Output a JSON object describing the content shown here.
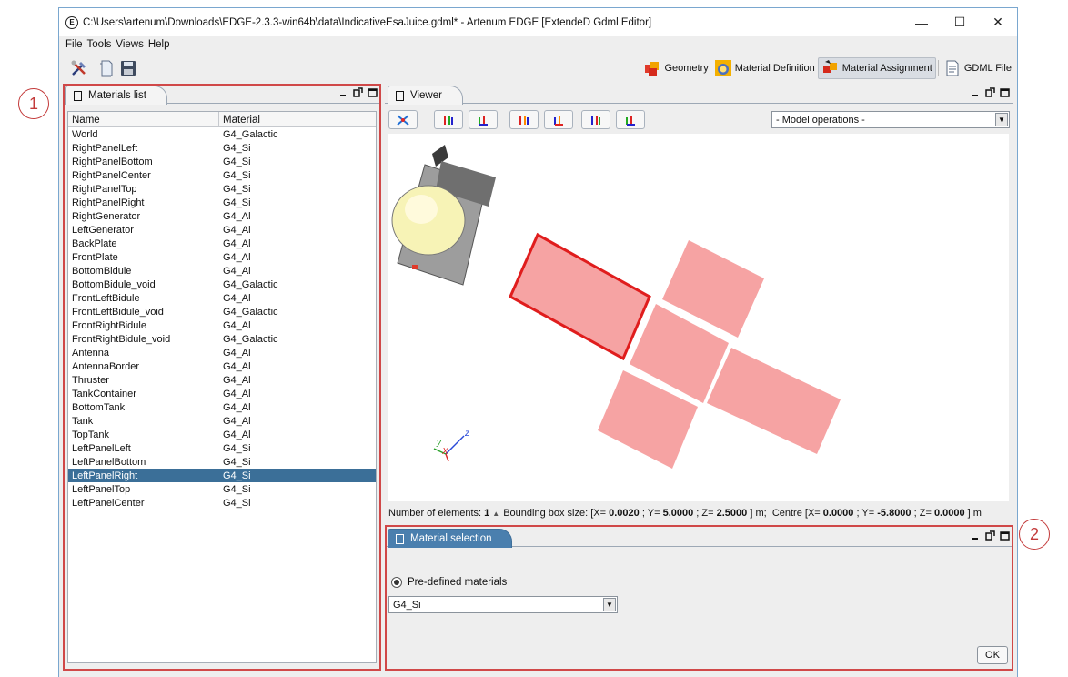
{
  "window": {
    "icon_letter": "E",
    "title": "C:\\Users\\artenum\\Downloads\\EDGE-2.3.3-win64b\\data\\IndicativeEsaJuice.gdml* - Artenum EDGE [ExtendeD Gdml Editor]",
    "controls": {
      "minimize": "—",
      "maximize": "☐",
      "close": "✕"
    }
  },
  "callouts": [
    "1",
    "2"
  ],
  "menu": [
    "File",
    "Tools",
    "Views",
    "Help"
  ],
  "toolbar": {
    "icons": [
      "tools-icon",
      "open-document-icon",
      "save-disk-icon"
    ]
  },
  "perspectives": [
    {
      "label": "Geometry",
      "icon": "geometry-cubes-icon",
      "active": false
    },
    {
      "label": "Material Definition",
      "icon": "material-definition-icon",
      "active": false
    },
    {
      "label": "Material Assignment",
      "icon": "material-assignment-icon",
      "active": true
    },
    {
      "label": "GDML File",
      "icon": "gdml-file-icon",
      "active": false
    }
  ],
  "materials_panel": {
    "tab": "Materials list",
    "columns": [
      "Name",
      "Material"
    ],
    "rows": [
      [
        "World",
        "G4_Galactic"
      ],
      [
        "RightPanelLeft",
        "G4_Si"
      ],
      [
        "RightPanelBottom",
        "G4_Si"
      ],
      [
        "RightPanelCenter",
        "G4_Si"
      ],
      [
        "RightPanelTop",
        "G4_Si"
      ],
      [
        "RightPanelRight",
        "G4_Si"
      ],
      [
        "RightGenerator",
        "G4_Al"
      ],
      [
        "LeftGenerator",
        "G4_Al"
      ],
      [
        "BackPlate",
        "G4_Al"
      ],
      [
        "FrontPlate",
        "G4_Al"
      ],
      [
        "BottomBidule",
        "G4_Al"
      ],
      [
        "BottomBidule_void",
        "G4_Galactic"
      ],
      [
        "FrontLeftBidule",
        "G4_Al"
      ],
      [
        "FrontLeftBidule_void",
        "G4_Galactic"
      ],
      [
        "FrontRightBidule",
        "G4_Al"
      ],
      [
        "FrontRightBidule_void",
        "G4_Galactic"
      ],
      [
        "Antenna",
        "G4_Al"
      ],
      [
        "AntennaBorder",
        "G4_Al"
      ],
      [
        "Thruster",
        "G4_Al"
      ],
      [
        "TankContainer",
        "G4_Al"
      ],
      [
        "BottomTank",
        "G4_Al"
      ],
      [
        "Tank",
        "G4_Al"
      ],
      [
        "TopTank",
        "G4_Al"
      ],
      [
        "LeftPanelLeft",
        "G4_Si"
      ],
      [
        "LeftPanelBottom",
        "G4_Si"
      ],
      [
        "LeftPanelRight",
        "G4_Si"
      ],
      [
        "LeftPanelTop",
        "G4_Si"
      ],
      [
        "LeftPanelCenter",
        "G4_Si"
      ]
    ],
    "selected_row": "LeftPanelRight"
  },
  "viewer_panel": {
    "tab": "Viewer",
    "view_buttons": [
      "reset-view-icon",
      "view-plus-x-icon",
      "view-minus-x-icon",
      "view-plus-y-icon",
      "view-minus-y-icon",
      "view-plus-z-icon",
      "view-minus-z-icon"
    ],
    "model_operations": "- Model operations -",
    "axes": {
      "x": "X",
      "y": "y",
      "z": "z"
    },
    "status": {
      "elements_label": "Number of elements:",
      "elements_value": "1",
      "elements_arrow": "▲",
      "bbox_label": "Bounding box size: [X=",
      "bbox_x": "0.0020",
      "sep_y": "; Y=",
      "bbox_y": "5.0000",
      "sep_z": "; Z=",
      "bbox_z": "2.5000",
      "bbox_unit": "] m;",
      "centre_label": "Centre [X=",
      "centre_x": "0.0000",
      "centre_y": "-5.8000",
      "centre_z": "0.0000",
      "centre_unit": "] m"
    },
    "colors": {
      "panel_fill": "#f6a3a3",
      "selected_outline": "#e01d1d",
      "tank_sphere": "#f7f3b6",
      "body_gray": "#8e8e8e"
    }
  },
  "material_selection_panel": {
    "tab": "Material selection",
    "radio_label": "Pre-defined materials",
    "selected_material": "G4_Si",
    "ok_label": "OK"
  },
  "panel_controls": {
    "minimize": "minimize-panel-icon",
    "float": "float-panel-icon",
    "maximize": "maximize-panel-icon"
  }
}
